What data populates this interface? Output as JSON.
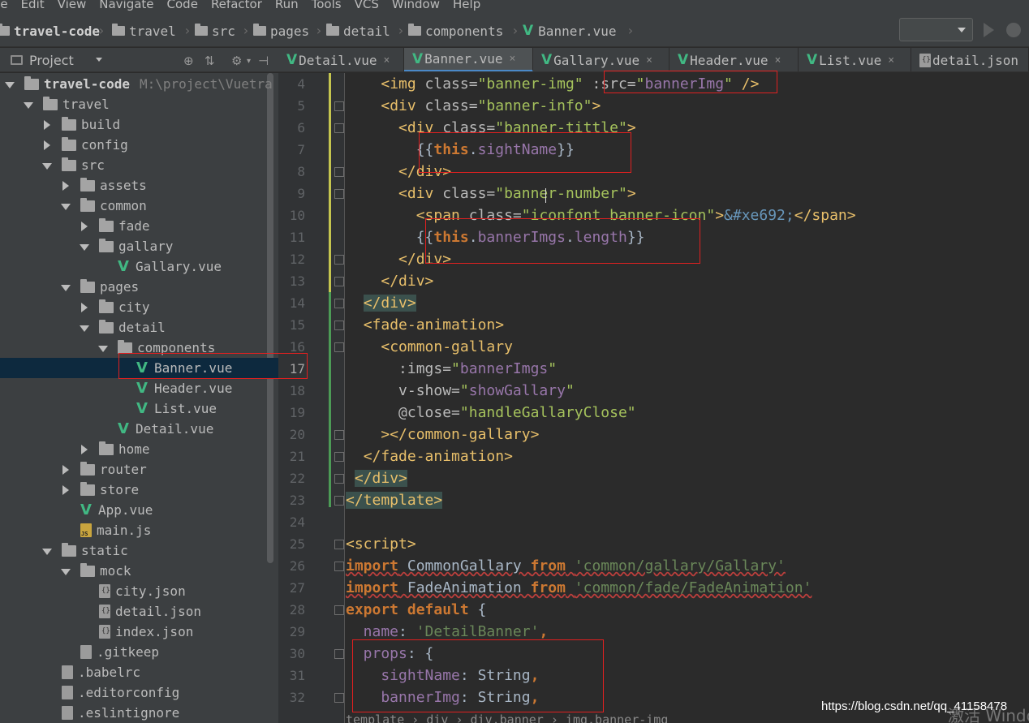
{
  "menu": [
    "ile",
    "Edit",
    "View",
    "Navigate",
    "Code",
    "Refactor",
    "Run",
    "Tools",
    "VCS",
    "Window",
    "Help"
  ],
  "breadcrumbs": [
    "travel-code",
    "travel",
    "src",
    "pages",
    "detail",
    "components",
    "Banner.vue"
  ],
  "project_panel": {
    "title": "Project"
  },
  "tree": [
    {
      "label": "travel-code",
      "extra": "M:\\project\\Vuetra",
      "depth": 0,
      "state": "open",
      "icon": "folder-icon",
      "bold": true
    },
    {
      "label": "travel",
      "depth": 1,
      "state": "open",
      "icon": "folder-icon"
    },
    {
      "label": "build",
      "depth": 2,
      "state": "closed",
      "icon": "folder-icon"
    },
    {
      "label": "config",
      "depth": 2,
      "state": "closed",
      "icon": "folder-icon"
    },
    {
      "label": "src",
      "depth": 2,
      "state": "open",
      "icon": "folder-icon"
    },
    {
      "label": "assets",
      "depth": 3,
      "state": "closed",
      "icon": "folder-icon"
    },
    {
      "label": "common",
      "depth": 3,
      "state": "open",
      "icon": "folder-icon"
    },
    {
      "label": "fade",
      "depth": 4,
      "state": "closed",
      "icon": "folder-icon"
    },
    {
      "label": "gallary",
      "depth": 4,
      "state": "open",
      "icon": "folder-icon"
    },
    {
      "label": "Gallary.vue",
      "depth": 5,
      "state": "leaf",
      "icon": "vue-icon"
    },
    {
      "label": "pages",
      "depth": 3,
      "state": "open",
      "icon": "folder-icon"
    },
    {
      "label": "city",
      "depth": 4,
      "state": "closed",
      "icon": "folder-icon"
    },
    {
      "label": "detail",
      "depth": 4,
      "state": "open",
      "icon": "folder-icon"
    },
    {
      "label": "components",
      "depth": 5,
      "state": "open",
      "icon": "folder-icon"
    },
    {
      "label": "Banner.vue",
      "depth": 6,
      "state": "leaf",
      "icon": "vue-icon",
      "selected": true
    },
    {
      "label": "Header.vue",
      "depth": 6,
      "state": "leaf",
      "icon": "vue-icon"
    },
    {
      "label": "List.vue",
      "depth": 6,
      "state": "leaf",
      "icon": "vue-icon"
    },
    {
      "label": "Detail.vue",
      "depth": 5,
      "state": "leaf",
      "icon": "vue-icon"
    },
    {
      "label": "home",
      "depth": 4,
      "state": "closed",
      "icon": "folder-icon"
    },
    {
      "label": "router",
      "depth": 3,
      "state": "closed",
      "icon": "folder-icon"
    },
    {
      "label": "store",
      "depth": 3,
      "state": "closed",
      "icon": "folder-icon"
    },
    {
      "label": "App.vue",
      "depth": 3,
      "state": "leaf",
      "icon": "vue-icon"
    },
    {
      "label": "main.js",
      "depth": 3,
      "state": "leaf",
      "icon": "js-file-icon"
    },
    {
      "label": "static",
      "depth": 2,
      "state": "open",
      "icon": "folder-icon"
    },
    {
      "label": "mock",
      "depth": 3,
      "state": "open",
      "icon": "folder-icon"
    },
    {
      "label": "city.json",
      "depth": 4,
      "state": "leaf",
      "icon": "json-file-icon"
    },
    {
      "label": "detail.json",
      "depth": 4,
      "state": "leaf",
      "icon": "json-file-icon"
    },
    {
      "label": "index.json",
      "depth": 4,
      "state": "leaf",
      "icon": "json-file-icon"
    },
    {
      "label": ".gitkeep",
      "depth": 3,
      "state": "leaf",
      "icon": "file-icon"
    },
    {
      "label": ".babelrc",
      "depth": 2,
      "state": "leaf",
      "icon": "file-icon"
    },
    {
      "label": ".editorconfig",
      "depth": 2,
      "state": "leaf",
      "icon": "file-icon"
    },
    {
      "label": ".eslintignore",
      "depth": 2,
      "state": "leaf",
      "icon": "file-icon"
    }
  ],
  "tabs": [
    {
      "label": "Detail.vue",
      "icon": "vue-icon",
      "active": false
    },
    {
      "label": "Banner.vue",
      "icon": "vue-icon",
      "active": true
    },
    {
      "label": "Gallary.vue",
      "icon": "vue-icon",
      "active": false
    },
    {
      "label": "Header.vue",
      "icon": "vue-icon",
      "active": false
    },
    {
      "label": "List.vue",
      "icon": "vue-icon",
      "active": false
    },
    {
      "label": "detail.json",
      "icon": "json-file-icon",
      "active": false
    }
  ],
  "line_numbers": [
    "4",
    "5",
    "6",
    "7",
    "8",
    "9",
    "10",
    "11",
    "12",
    "13",
    "14",
    "15",
    "16",
    "17",
    "18",
    "19",
    "20",
    "21",
    "22",
    "23",
    "24",
    "25",
    "26",
    "27",
    "28",
    "29",
    "30",
    "31",
    "32"
  ],
  "current_line": "17",
  "code": [
    [
      [
        "    ",
        ""
      ],
      [
        "<img ",
        "tag"
      ],
      [
        "class=",
        "attr"
      ],
      [
        "\"banner-img\"",
        "str"
      ],
      [
        " :src=",
        "attr"
      ],
      [
        "\"",
        "str"
      ],
      [
        "bannerImg",
        "vuestr"
      ],
      [
        "\"",
        "str"
      ],
      [
        " />",
        "tag"
      ]
    ],
    [
      [
        "    ",
        ""
      ],
      [
        "<div ",
        "tag"
      ],
      [
        "class=",
        "attr"
      ],
      [
        "\"banner-info\"",
        "str"
      ],
      [
        ">",
        "tag"
      ]
    ],
    [
      [
        "      ",
        ""
      ],
      [
        "<div ",
        "tag"
      ],
      [
        "class=",
        "attr"
      ],
      [
        "\"banner-tittle\"",
        "str"
      ],
      [
        ">",
        "tag"
      ]
    ],
    [
      [
        "        {{",
        "ident"
      ],
      [
        "this",
        "kw"
      ],
      [
        ".",
        "ident"
      ],
      [
        "sightName",
        "prop"
      ],
      [
        "}}",
        "ident"
      ]
    ],
    [
      [
        "      ",
        ""
      ],
      [
        "</div>",
        "tag"
      ]
    ],
    [
      [
        "      ",
        ""
      ],
      [
        "<div ",
        "tag"
      ],
      [
        "class=",
        "attr"
      ],
      [
        "\"banner-number\"",
        "str"
      ],
      [
        ">",
        "tag"
      ]
    ],
    [
      [
        "        ",
        ""
      ],
      [
        "<span ",
        "tag"
      ],
      [
        "class=",
        "attr"
      ],
      [
        "\"iconfont banner-icon\"",
        "str"
      ],
      [
        ">",
        "tag"
      ],
      [
        "&#xe692;",
        "ent"
      ],
      [
        "</span>",
        "tag"
      ]
    ],
    [
      [
        "        {{",
        "ident"
      ],
      [
        "this",
        "kw"
      ],
      [
        ".",
        "ident"
      ],
      [
        "bannerImgs",
        "prop"
      ],
      [
        ".",
        "ident"
      ],
      [
        "length",
        "prop"
      ],
      [
        "}}",
        "ident"
      ]
    ],
    [
      [
        "      ",
        ""
      ],
      [
        "</div>",
        "tag"
      ]
    ],
    [
      [
        "    ",
        ""
      ],
      [
        "</div>",
        "tag"
      ]
    ],
    [
      [
        "  ",
        ""
      ],
      [
        "</div>",
        "tag hl-tag"
      ]
    ],
    [
      [
        "  ",
        ""
      ],
      [
        "<fade-animation>",
        "tag"
      ]
    ],
    [
      [
        "    ",
        ""
      ],
      [
        "<common-gallary",
        "tag"
      ]
    ],
    [
      [
        "      :imgs=",
        "attr"
      ],
      [
        "\"",
        "str"
      ],
      [
        "bannerImgs",
        "vuestr"
      ],
      [
        "\"",
        "str"
      ]
    ],
    [
      [
        "      v-show=",
        "attr"
      ],
      [
        "\"",
        "str"
      ],
      [
        "showGallary",
        "vuestr"
      ],
      [
        "\"",
        "str"
      ]
    ],
    [
      [
        "      @close=",
        "attr"
      ],
      [
        "\"handleGallaryClose\"",
        "str"
      ]
    ],
    [
      [
        "    ",
        ""
      ],
      [
        "></common-gallary>",
        "tag"
      ]
    ],
    [
      [
        "  ",
        ""
      ],
      [
        "</fade-animation>",
        "tag"
      ]
    ],
    [
      [
        " ",
        ""
      ],
      [
        "</div>",
        "tag hl-tag"
      ]
    ],
    [
      [
        "</template>",
        "tag hl-tag"
      ]
    ],
    [
      [
        "",
        ""
      ]
    ],
    [
      [
        "<script>",
        "tag"
      ]
    ],
    [
      [
        "import",
        "kw warn"
      ],
      [
        " CommonGallary ",
        "ident warn"
      ],
      [
        "from",
        "kw warn"
      ],
      [
        " ",
        "ident warn"
      ],
      [
        "'common/gallary/Gallary'",
        "strq warn"
      ]
    ],
    [
      [
        "import",
        "kw warn"
      ],
      [
        " FadeAnimation ",
        "ident warn"
      ],
      [
        "from",
        "kw warn"
      ],
      [
        " ",
        "ident warn"
      ],
      [
        "'common/fade/FadeAnimation'",
        "strq warn"
      ]
    ],
    [
      [
        "export default",
        "kw"
      ],
      [
        " {",
        "ident"
      ]
    ],
    [
      [
        "  name",
        "prop"
      ],
      [
        ": ",
        "ident"
      ],
      [
        "'DetailBanner'",
        "strq"
      ],
      [
        ",",
        "kw"
      ]
    ],
    [
      [
        "  props",
        "prop"
      ],
      [
        ": {",
        "ident"
      ]
    ],
    [
      [
        "    sightName",
        "prop"
      ],
      [
        ": String",
        "ident"
      ],
      [
        ",",
        "kw"
      ]
    ],
    [
      [
        "    bannerImg",
        "prop"
      ],
      [
        ": String",
        "ident"
      ],
      [
        ",",
        "kw"
      ]
    ]
  ],
  "bottom_breadcrumb": "template  › div  › div.banner  › img.banner-img",
  "watermark": "https://blog.csdn.net/qq_41158478",
  "watermark_os": "激活 Windo"
}
